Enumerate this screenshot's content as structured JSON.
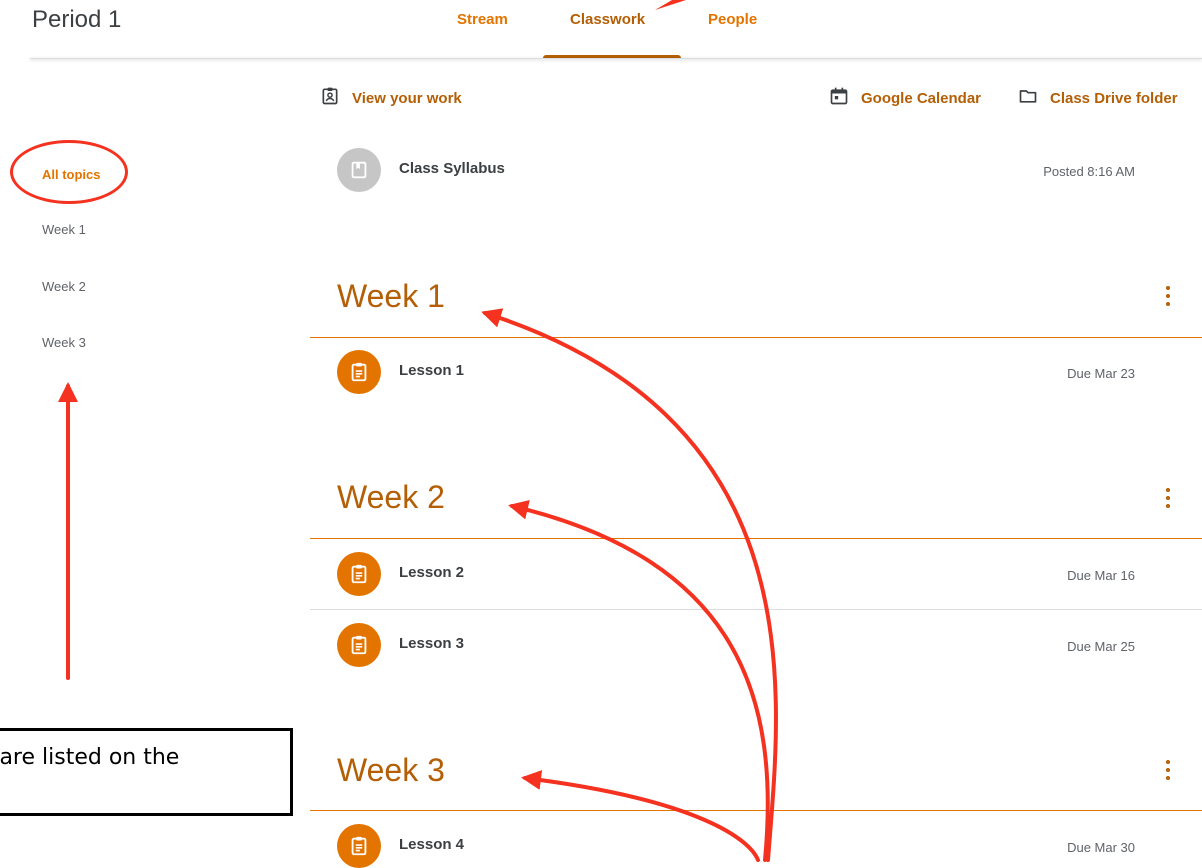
{
  "header": {
    "class_title": "Period 1",
    "tabs": [
      {
        "label": "Stream"
      },
      {
        "label": "Classwork"
      },
      {
        "label": "People"
      }
    ]
  },
  "toolbar": {
    "view_work": "View your work",
    "google_calendar": "Google Calendar",
    "class_drive": "Class Drive folder"
  },
  "sidebar": {
    "items": [
      {
        "label": "All topics"
      },
      {
        "label": "Week 1"
      },
      {
        "label": "Week 2"
      },
      {
        "label": "Week 3"
      }
    ]
  },
  "syllabus": {
    "title": "Class Syllabus",
    "meta": "Posted 8:16 AM"
  },
  "topics": [
    {
      "title": "Week 1",
      "items": [
        {
          "title": "Lesson 1",
          "due": "Due Mar 23"
        }
      ]
    },
    {
      "title": "Week 2",
      "items": [
        {
          "title": "Lesson 2",
          "due": "Due Mar 16"
        },
        {
          "title": "Lesson 3",
          "due": "Due Mar 25"
        }
      ]
    },
    {
      "title": "Week 3",
      "items": [
        {
          "title": "Lesson 4",
          "due": "Due Mar 30"
        }
      ]
    }
  ],
  "annotation": {
    "text": "s are listed on the"
  },
  "colors": {
    "accent": "#e37400",
    "accent_dark": "#b45f06",
    "annotation_red": "#f4321f"
  },
  "icons": [
    "assignment-ind-icon",
    "calendar-icon",
    "folder-icon",
    "material-icon",
    "assignment-icon",
    "more-vert-icon"
  ]
}
